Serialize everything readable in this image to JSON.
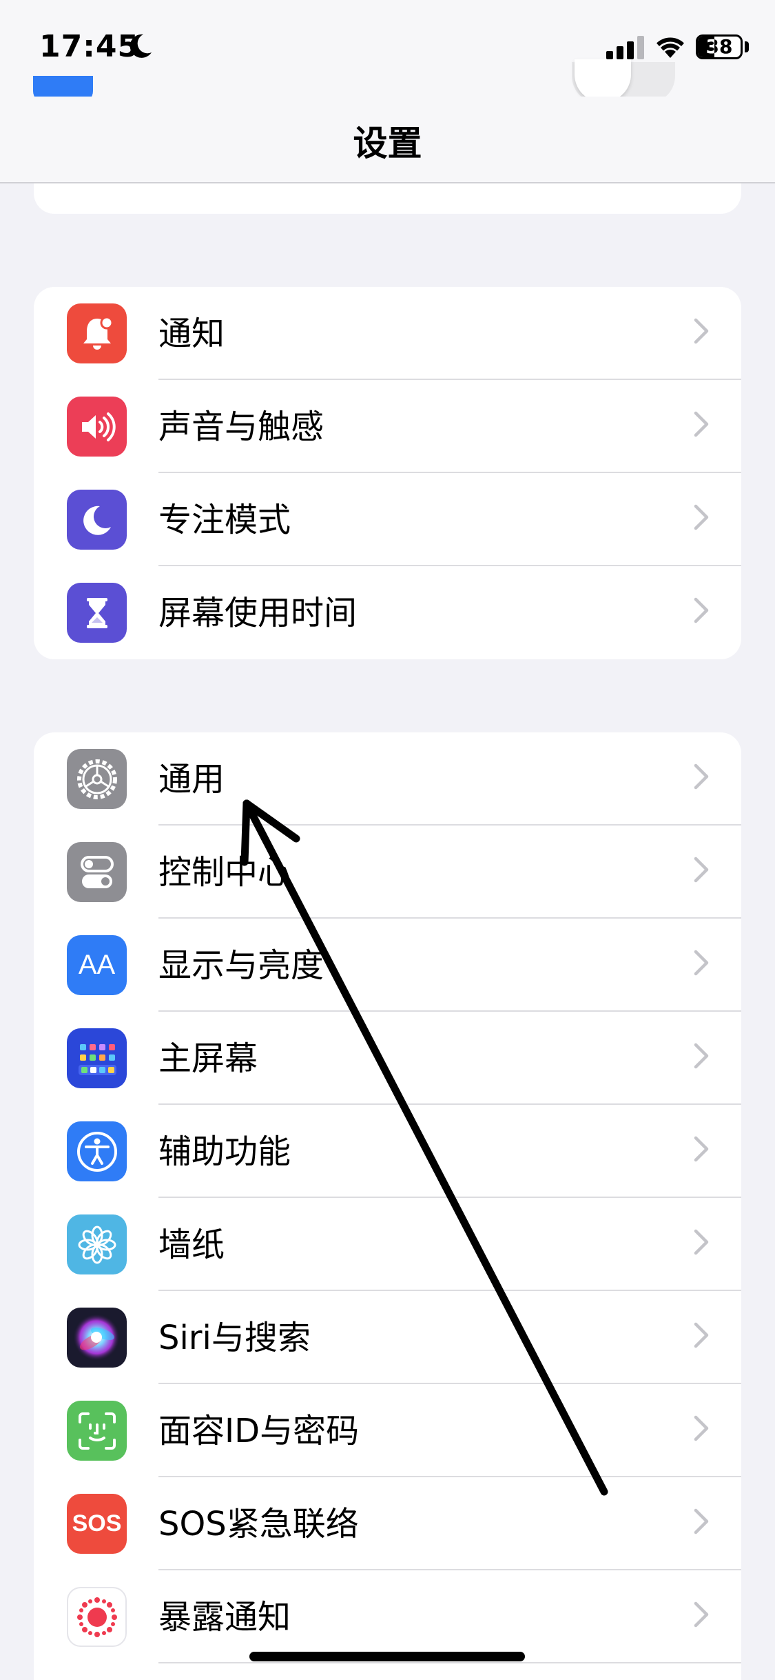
{
  "status_bar": {
    "time": "17:45",
    "battery": "38",
    "battery_level": 0.38
  },
  "nav": {
    "title": "设置"
  },
  "colors": {
    "background": "#f2f2f7",
    "notifications": "#ee4b3d",
    "sounds": "#ec3e57",
    "focus": "#5b4fd4",
    "screen_time": "#5b4fd4",
    "general": "#8e8e93",
    "control_center": "#8e8e93",
    "display": "#2f7cf6",
    "home_screen": "#2b47d9",
    "accessibility": "#2f7cf6",
    "wallpaper": "#4fb6e4",
    "siri": "#1a1a2e",
    "face_id": "#58c15c",
    "sos": "#ee4b3d",
    "exposure": "#ffffff"
  },
  "group1": {
    "items": [
      {
        "label": "通知",
        "icon": "bell-icon"
      },
      {
        "label": "声音与触感",
        "icon": "speaker-icon"
      },
      {
        "label": "专注模式",
        "icon": "moon-icon"
      },
      {
        "label": "屏幕使用时间",
        "icon": "hourglass-icon"
      }
    ]
  },
  "group2": {
    "items": [
      {
        "label": "通用",
        "icon": "gear-icon"
      },
      {
        "label": "控制中心",
        "icon": "toggles-icon"
      },
      {
        "label": "显示与亮度",
        "icon": "text-size-icon",
        "icon_text": "AA"
      },
      {
        "label": "主屏幕",
        "icon": "app-grid-icon"
      },
      {
        "label": "辅助功能",
        "icon": "accessibility-icon"
      },
      {
        "label": "墙纸",
        "icon": "flower-icon"
      },
      {
        "label": "Siri与搜索",
        "icon": "siri-icon"
      },
      {
        "label": "面容ID与密码",
        "icon": "face-id-icon"
      },
      {
        "label": "SOS紧急联络",
        "icon": "sos-icon",
        "icon_text": "SOS"
      },
      {
        "label": "暴露通知",
        "icon": "exposure-icon"
      }
    ]
  }
}
